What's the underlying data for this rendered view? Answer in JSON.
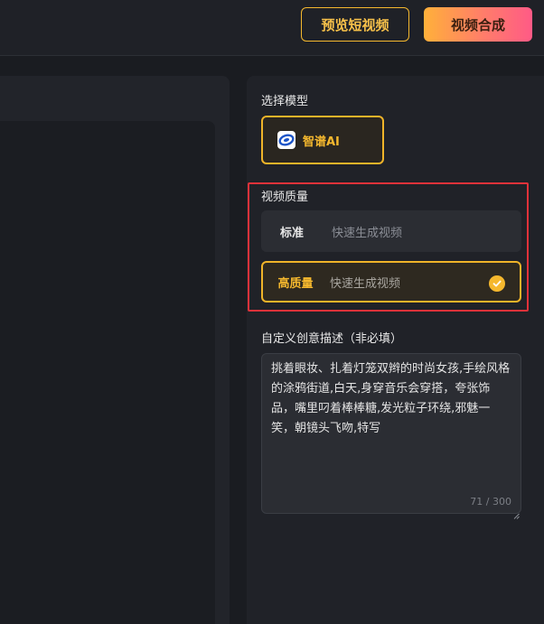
{
  "toolbar": {
    "preview_label": "预览短视频",
    "compose_label": "视频合成"
  },
  "model_section": {
    "label": "选择模型",
    "selected": {
      "name": "智谱AI",
      "icon": "zhipu-logo-icon"
    }
  },
  "quality_section": {
    "label": "视频质量",
    "options": [
      {
        "name": "标准",
        "desc": "快速生成视频",
        "selected": false
      },
      {
        "name": "高质量",
        "desc": "快速生成视频",
        "selected": true
      }
    ]
  },
  "prompt_section": {
    "label": "自定义创意描述（非必填）",
    "value": "挑着眼妆、扎着灯笼双辫的时尚女孩,手绘风格的涂鸦街道,白天,身穿音乐会穿搭，夸张饰品，嘴里叼着棒棒糖,发光粒子环绕,邪魅一笑，朝镜头飞吻,特写",
    "counter": "71 / 300"
  },
  "colors": {
    "accent": "#f5b82e",
    "highlight_border": "#e0323a",
    "background": "#1a1c21"
  }
}
